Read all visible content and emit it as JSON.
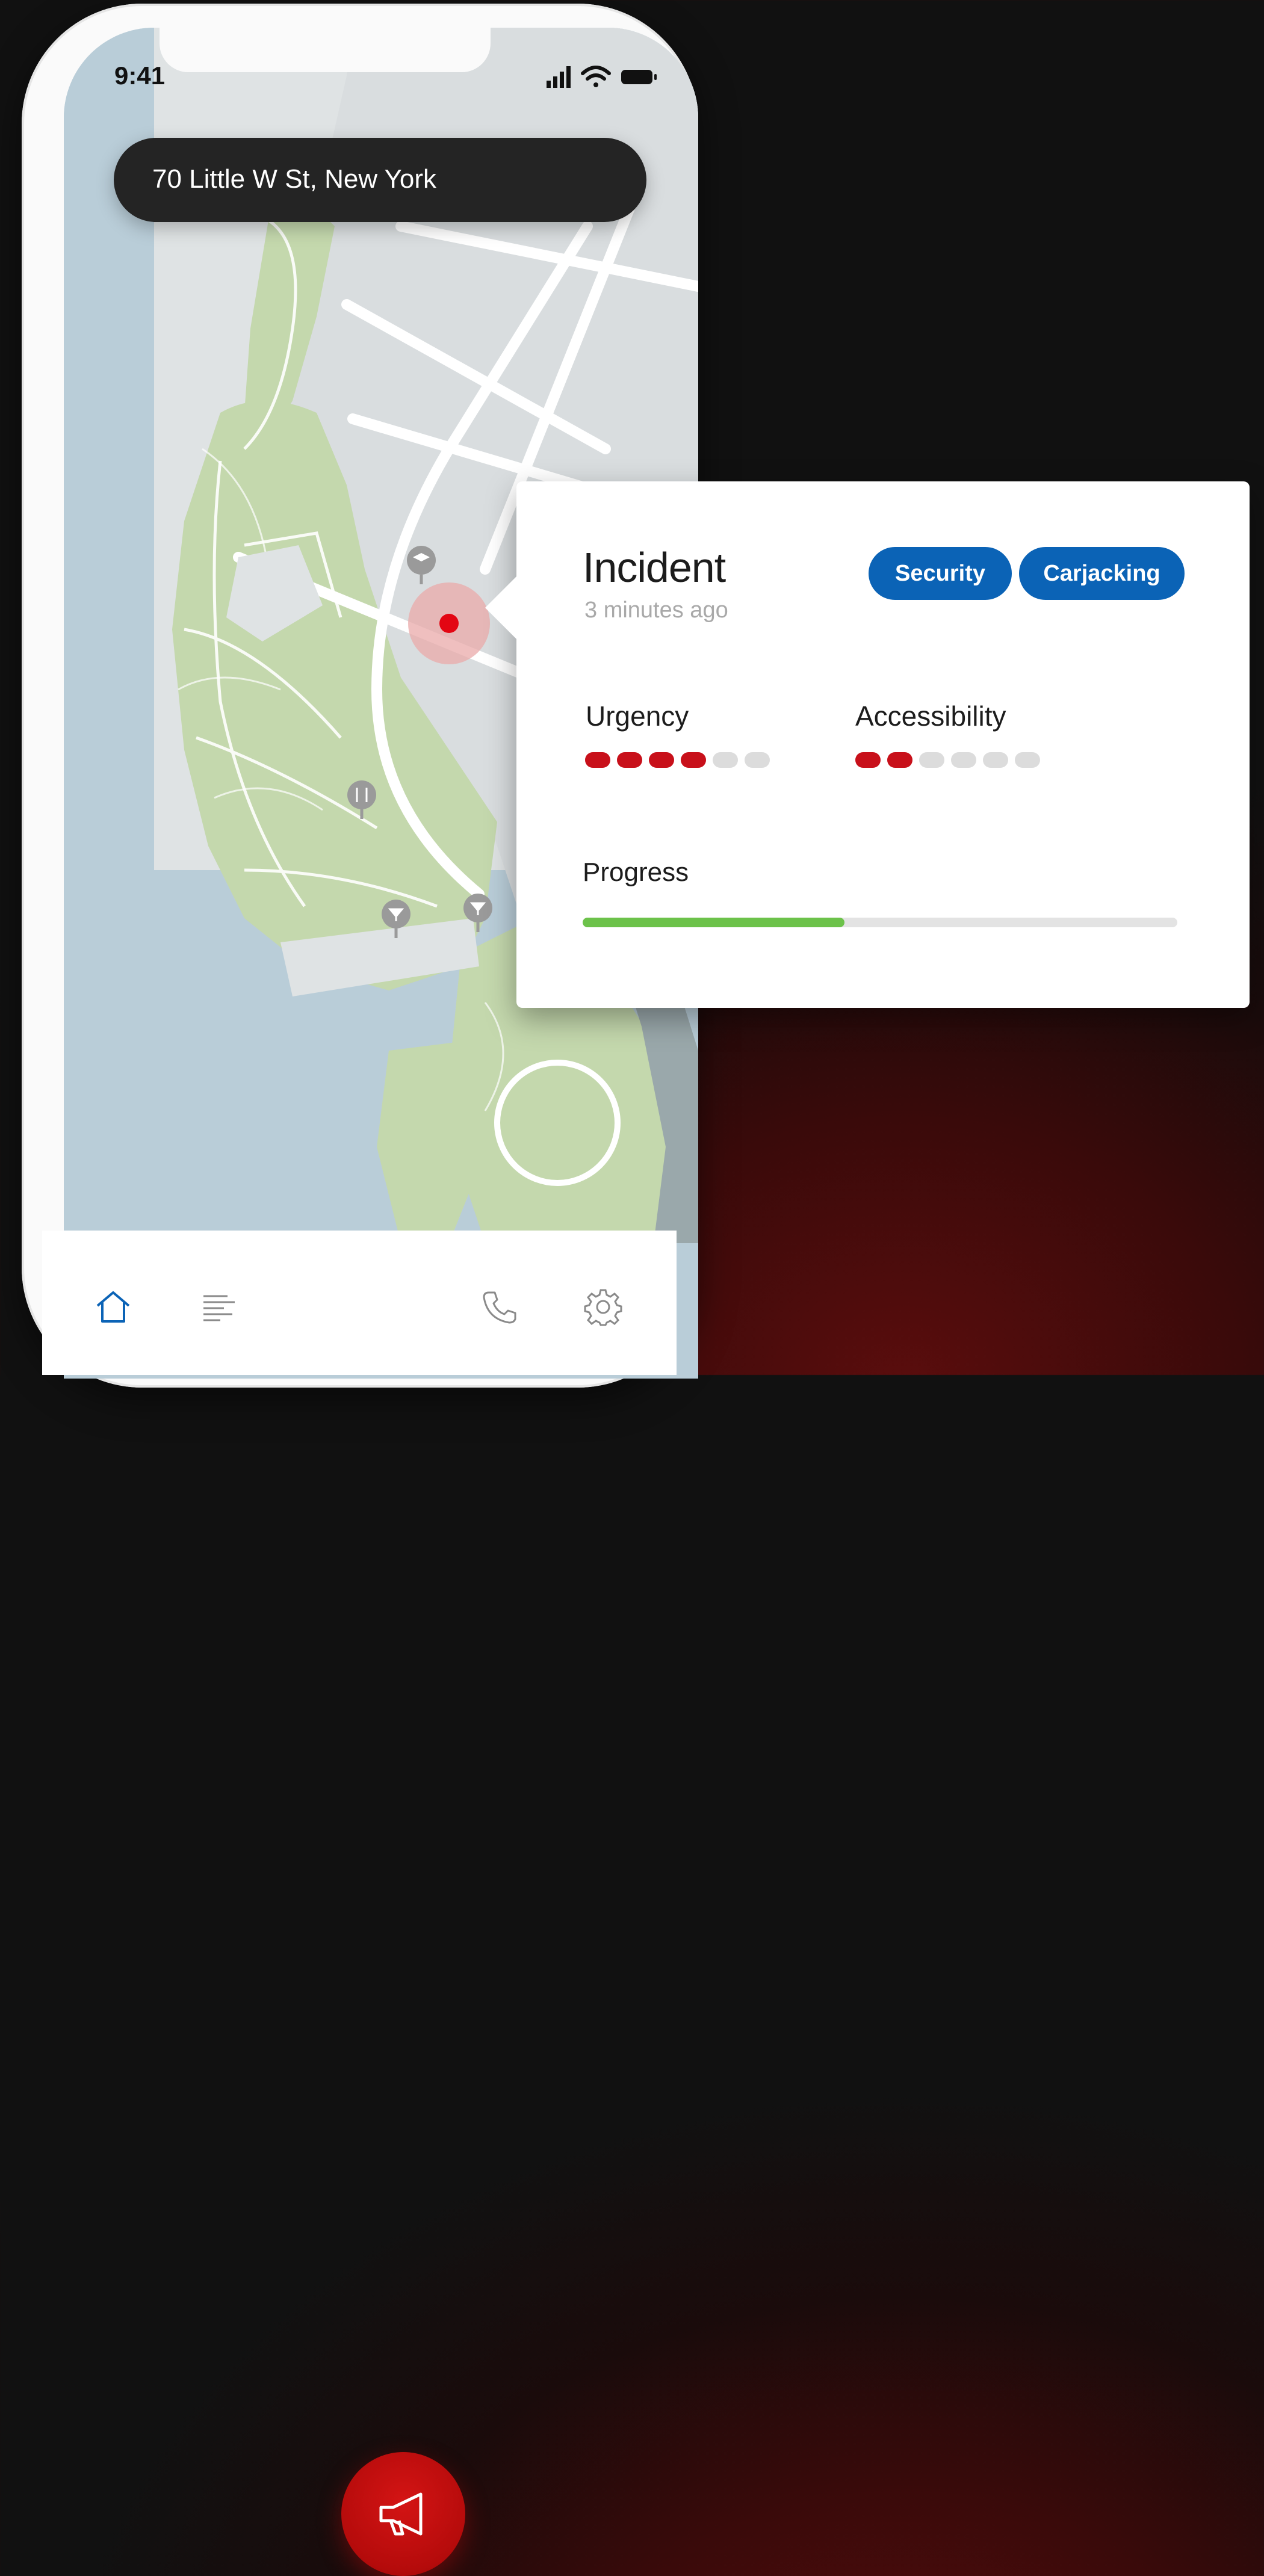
{
  "status_bar": {
    "time": "9:41"
  },
  "search": {
    "address": "70 Little W St, New York"
  },
  "map": {
    "icons": [
      "graduation-cap-icon",
      "restaurant-icon",
      "bar-icon",
      "bar-icon"
    ],
    "incident_marker_color": "#e30613"
  },
  "tab_bar": {
    "items": [
      "home-icon",
      "list-icon",
      "megaphone-icon",
      "phone-icon",
      "gear-icon"
    ],
    "active_color": "#0b63b6",
    "sos_color": "#c20b0b"
  },
  "incident_card": {
    "title": "Incident",
    "time_ago": "3 minutes ago",
    "tags": [
      "Security",
      "Carjacking"
    ],
    "tag_color": "#0b63b6",
    "urgency": {
      "label": "Urgency",
      "level": 4,
      "max": 6
    },
    "accessibility": {
      "label": "Accessibility",
      "level": 2,
      "max": 6
    },
    "progress": {
      "label": "Progress",
      "value": 0.44
    },
    "active_dot_color": "#c8101a",
    "progress_color": "#6cc24a"
  }
}
